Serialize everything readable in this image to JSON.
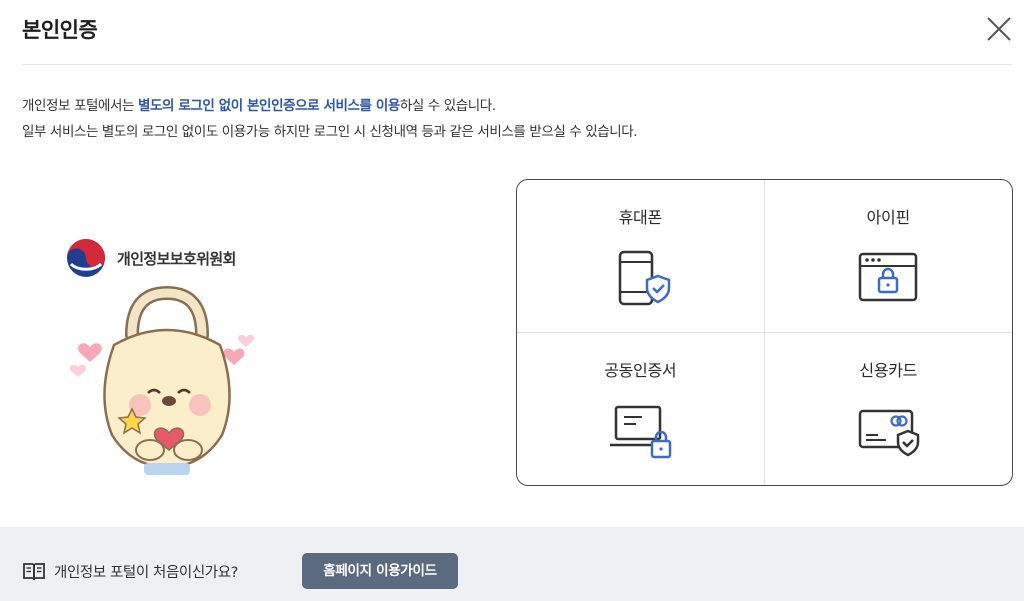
{
  "dialog": {
    "title": "본인인증",
    "close_icon": "close-icon"
  },
  "description": {
    "line1_prefix": "개인정보 포털에서는 ",
    "line1_highlight": "별도의 로그인 없이 본인인증으로 서비스를 이용",
    "line1_suffix": "하실 수 있습니다.",
    "line2": "일부 서비스는 별도의 로그인 없이도 이용가능 하지만 로그인 시 신청내역 등과 같은 서비스를 받으실 수 있습니다."
  },
  "organization": {
    "name": "개인정보보호위원회",
    "emblem_icon": "taegeuk-emblem-icon"
  },
  "auth_methods": [
    {
      "label": "휴대폰",
      "icon": "mobile-phone-shield-icon"
    },
    {
      "label": "아이핀",
      "icon": "browser-lock-icon"
    },
    {
      "label": "공동인증서",
      "icon": "laptop-lock-icon"
    },
    {
      "label": "신용카드",
      "icon": "credit-card-shield-icon"
    }
  ],
  "footer": {
    "question": "개인정보 포털이 처음이신가요?",
    "guide_button": "홈페이지 이용가이드",
    "book_icon": "book-icon"
  },
  "colors": {
    "highlight": "#2f56a6",
    "footer_bg": "#eef0f3",
    "button_bg": "#5c6a80",
    "icon_blue": "#3d6bc4"
  }
}
